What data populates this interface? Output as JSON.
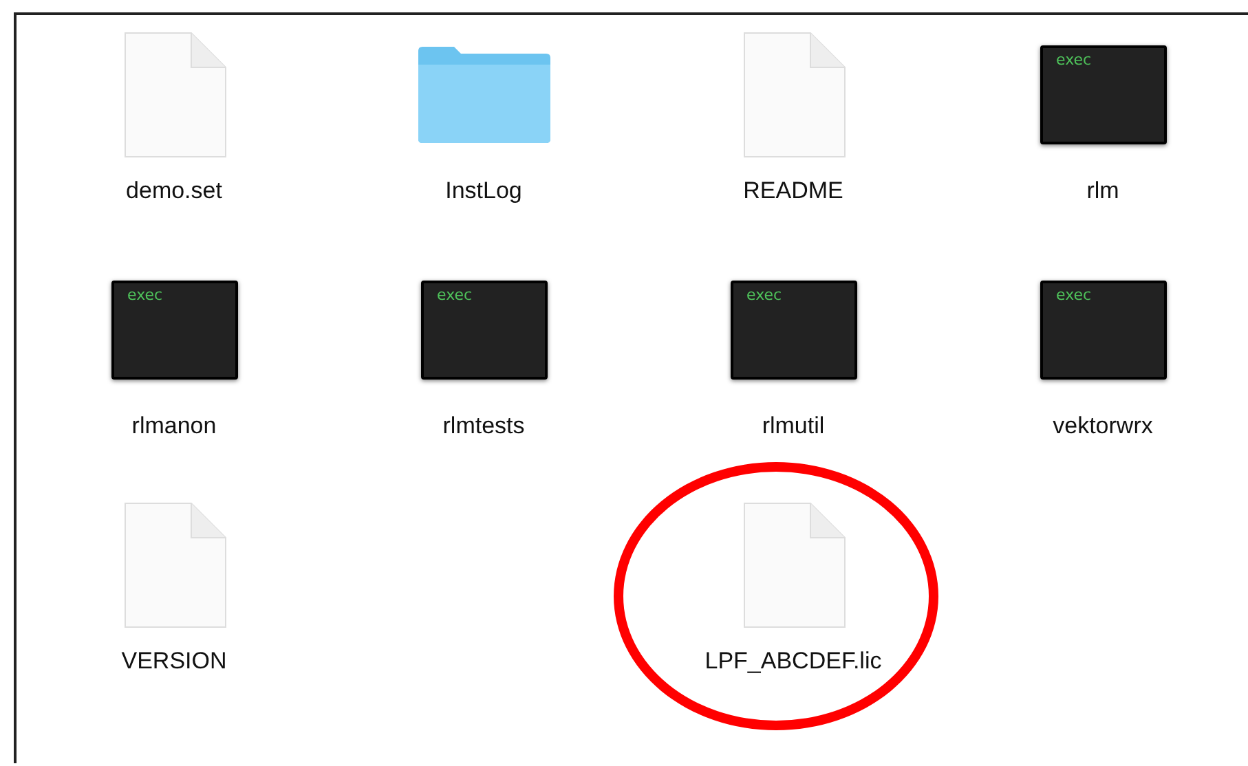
{
  "files": [
    {
      "name": "demo.set",
      "kind": "document",
      "circled": false
    },
    {
      "name": "InstLog",
      "kind": "folder",
      "circled": false
    },
    {
      "name": "README",
      "kind": "document",
      "circled": false
    },
    {
      "name": "rlm",
      "kind": "exec",
      "icon_text": "exec",
      "circled": false
    },
    {
      "name": "rlmanon",
      "kind": "exec",
      "icon_text": "exec",
      "circled": false
    },
    {
      "name": "rlmtests",
      "kind": "exec",
      "icon_text": "exec",
      "circled": false
    },
    {
      "name": "rlmutil",
      "kind": "exec",
      "icon_text": "exec",
      "circled": false
    },
    {
      "name": "vektorwrx",
      "kind": "exec",
      "icon_text": "exec",
      "circled": false
    },
    {
      "name": "VERSION",
      "kind": "document",
      "circled": false
    },
    {
      "kind": "empty"
    },
    {
      "name": "LPF_ABCDEF.lic",
      "kind": "document",
      "circled": true
    }
  ]
}
